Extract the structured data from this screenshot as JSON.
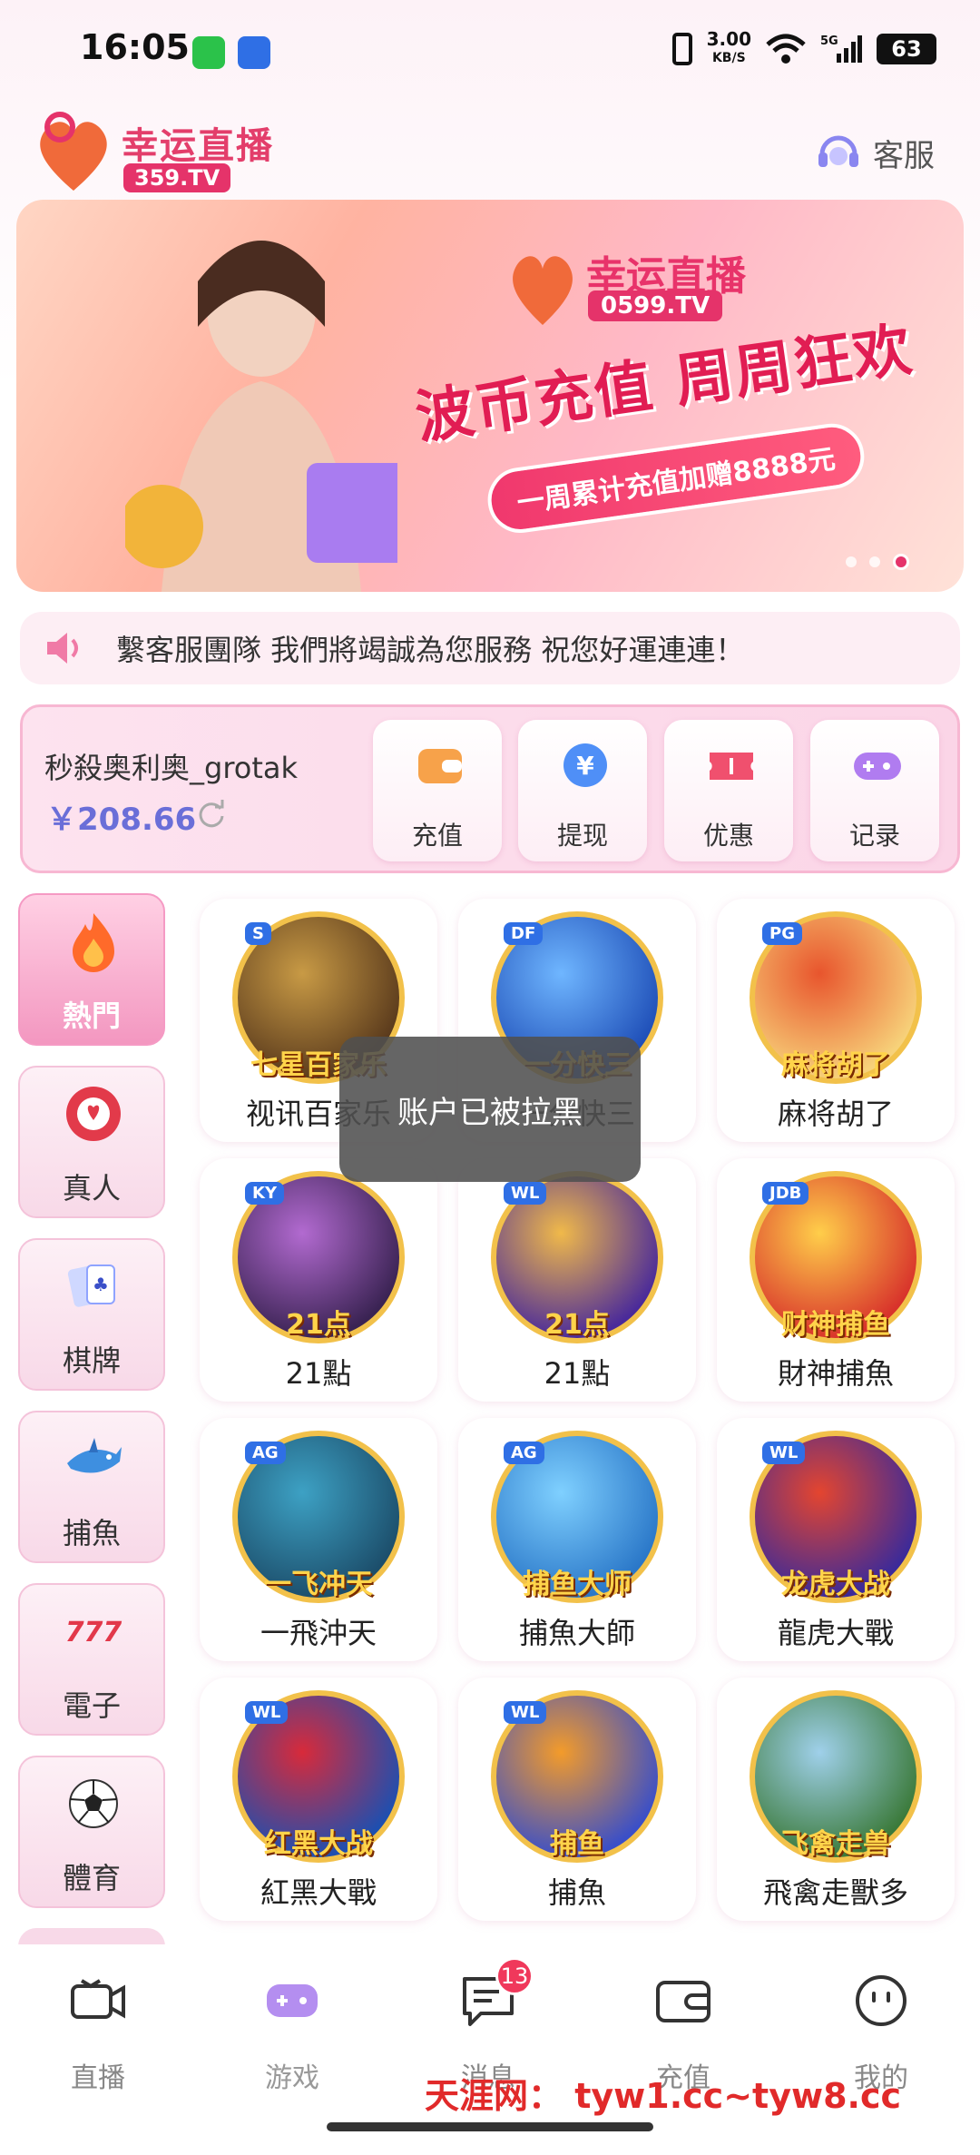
{
  "status_bar": {
    "time": "16:05",
    "net_speed_value": "3.00",
    "net_speed_unit": "KB/S",
    "network": "5G",
    "battery": "63"
  },
  "header": {
    "logo_name": "幸运直播",
    "logo_domain": "359.TV",
    "customer_service_label": "客服"
  },
  "banner": {
    "logo_name": "幸运直播",
    "logo_domain": "0599.TV",
    "headline": "波币充值 周周狂欢",
    "pill_text": "一周累计充值加赠8888元",
    "slide_count": 3,
    "active_slide": 3
  },
  "marquee": {
    "text": "繫客服團隊 我們將竭誠為您服務 祝您好運連連！"
  },
  "account": {
    "username": "秒殺奥利奥_grotak",
    "balance": "￥208.66",
    "actions": [
      {
        "label": "充值",
        "icon": "wallet-icon",
        "color": "#f7a24a"
      },
      {
        "label": "提现",
        "icon": "yen-coin-icon",
        "color": "#4f8ff7"
      },
      {
        "label": "优惠",
        "icon": "ticket-icon",
        "color": "#f0506e"
      },
      {
        "label": "记录",
        "icon": "gamepad-icon",
        "color": "#b07cf0"
      }
    ]
  },
  "categories": [
    {
      "label": "熱門",
      "icon": "flame-icon",
      "active": true
    },
    {
      "label": "真人",
      "icon": "chip-icon",
      "active": false
    },
    {
      "label": "棋牌",
      "icon": "cards-icon",
      "active": false
    },
    {
      "label": "捕魚",
      "icon": "shark-icon",
      "active": false
    },
    {
      "label": "電子",
      "icon": "slot-777-icon",
      "active": false
    },
    {
      "label": "體育",
      "icon": "soccer-ball-icon",
      "active": false
    }
  ],
  "games": [
    {
      "label": "视讯百家乐",
      "art_text": "七星百家乐",
      "provider": "S",
      "colors": [
        "#5a3a1c",
        "#c89a45"
      ]
    },
    {
      "label": "一分快三",
      "art_text": "一分快三",
      "provider": "DF",
      "colors": [
        "#1f4fb8",
        "#6fb6ff"
      ]
    },
    {
      "label": "麻将胡了",
      "art_text": "麻将胡了",
      "provider": "PG",
      "colors": [
        "#f7d27a",
        "#e8552d"
      ]
    },
    {
      "label": "21點",
      "art_text": "21点",
      "provider": "KY",
      "colors": [
        "#3a2353",
        "#b26ad0"
      ]
    },
    {
      "label": "21點",
      "art_text": "21点",
      "provider": "WL",
      "colors": [
        "#4a2a9a",
        "#f0b94a"
      ]
    },
    {
      "label": "財神捕魚",
      "art_text": "财神捕鱼",
      "provider": "JDB",
      "colors": [
        "#d8322b",
        "#ffce4a"
      ]
    },
    {
      "label": "一飛沖天",
      "art_text": "一飞冲天",
      "provider": "AG",
      "colors": [
        "#1c4e6b",
        "#3da1c4"
      ]
    },
    {
      "label": "捕魚大師",
      "art_text": "捕鱼大师",
      "provider": "AG",
      "colors": [
        "#2a77c8",
        "#7fd0ff"
      ]
    },
    {
      "label": "龍虎大戰",
      "art_text": "龙虎大战",
      "provider": "WL",
      "colors": [
        "#3a2a9a",
        "#e4452f"
      ]
    },
    {
      "label": "紅黑大戰",
      "art_text": "红黑大战",
      "provider": "WL",
      "colors": [
        "#1d4fb0",
        "#d82a3a"
      ]
    },
    {
      "label": "捕魚",
      "art_text": "捕鱼",
      "provider": "WL",
      "colors": [
        "#3a4fc8",
        "#f39b2a"
      ]
    },
    {
      "label": "飛禽走獸多",
      "art_text": "飞禽走兽",
      "provider": "",
      "colors": [
        "#3b7a3a",
        "#9fd0ea"
      ]
    }
  ],
  "toast": {
    "text": "账户已被拉黑"
  },
  "bottom_nav": [
    {
      "label": "直播",
      "icon": "camera-icon"
    },
    {
      "label": "游戏",
      "icon": "gamepad-icon"
    },
    {
      "label": "消息",
      "icon": "message-icon",
      "badge": "13"
    },
    {
      "label": "充值",
      "icon": "wallet-icon"
    },
    {
      "label": "我的",
      "icon": "face-icon"
    }
  ],
  "watermark": "天涯网： tyw1.cc~tyw8.cc",
  "colors": {
    "brand_pink": "#e5336a",
    "accent_purple": "#6a6ed8",
    "badge_red": "#f0385b"
  }
}
